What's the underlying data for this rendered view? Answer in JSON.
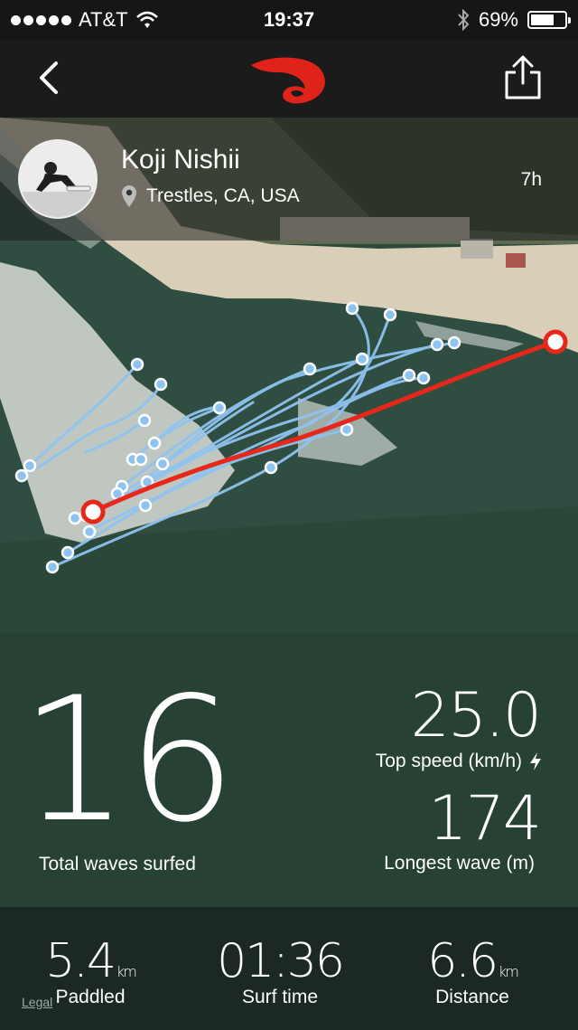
{
  "status": {
    "carrier": "AT&T",
    "time": "19:37",
    "battery": "69%",
    "battery_level": 0.69
  },
  "profile": {
    "name": "Koji Nishii",
    "location": "Trestles, CA, USA",
    "ago": "7h"
  },
  "stats": {
    "waves_value": "16",
    "waves_label": "Total waves surfed",
    "speed_value": "25.0",
    "speed_label": "Top speed (km/h)",
    "longest_value": "174",
    "longest_label": "Longest wave (m)"
  },
  "bottom": {
    "paddled_value": "5.4",
    "paddled_unit": "km",
    "paddled_label": "Paddled",
    "time_value": "01:36",
    "time_label": "Surf time",
    "distance_value": "6.6",
    "distance_unit": "km",
    "distance_label": "Distance"
  },
  "legal": "Legal",
  "icons": {
    "back": "chevron-left-icon",
    "share": "share-icon",
    "logo": "ripcurl-logo",
    "location": "location-pin-icon",
    "bolt": "lightning-icon"
  },
  "colors": {
    "track": "#8ec3f0",
    "route": "#e8271b",
    "logo": "#e0231a"
  }
}
